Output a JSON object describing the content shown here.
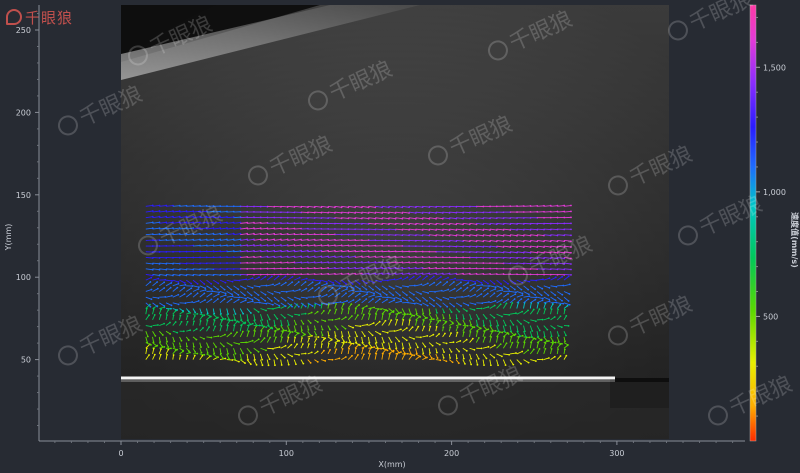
{
  "brand": {
    "logo_text": "千眼狼",
    "watermark_text": "千眼狼"
  },
  "plot": {
    "x_axis_label": "X(mm)",
    "y_axis_label": "Y(mm)",
    "x_ticks": [
      "0",
      "100",
      "200",
      "300"
    ],
    "y_ticks": [
      "50",
      "100",
      "150",
      "200",
      "250"
    ],
    "x_range": [
      -50,
      380
    ],
    "y_range": [
      0,
      260
    ]
  },
  "colorbar": {
    "title": "速度值(mm/s)",
    "ticks": [
      "500",
      "1,000",
      "1,500"
    ],
    "range": [
      0,
      1750
    ],
    "colors": [
      "#ff2a00",
      "#ffae00",
      "#e8f000",
      "#5ad800",
      "#00c95a",
      "#00c6c8",
      "#1e6cff",
      "#2a1cff",
      "#8a2cff",
      "#e33ad8",
      "#ff3aa6"
    ]
  },
  "vector_field": {
    "x_range": [
      15,
      268
    ],
    "y_range": [
      50,
      143
    ],
    "rows": 28,
    "cols": 63
  }
}
